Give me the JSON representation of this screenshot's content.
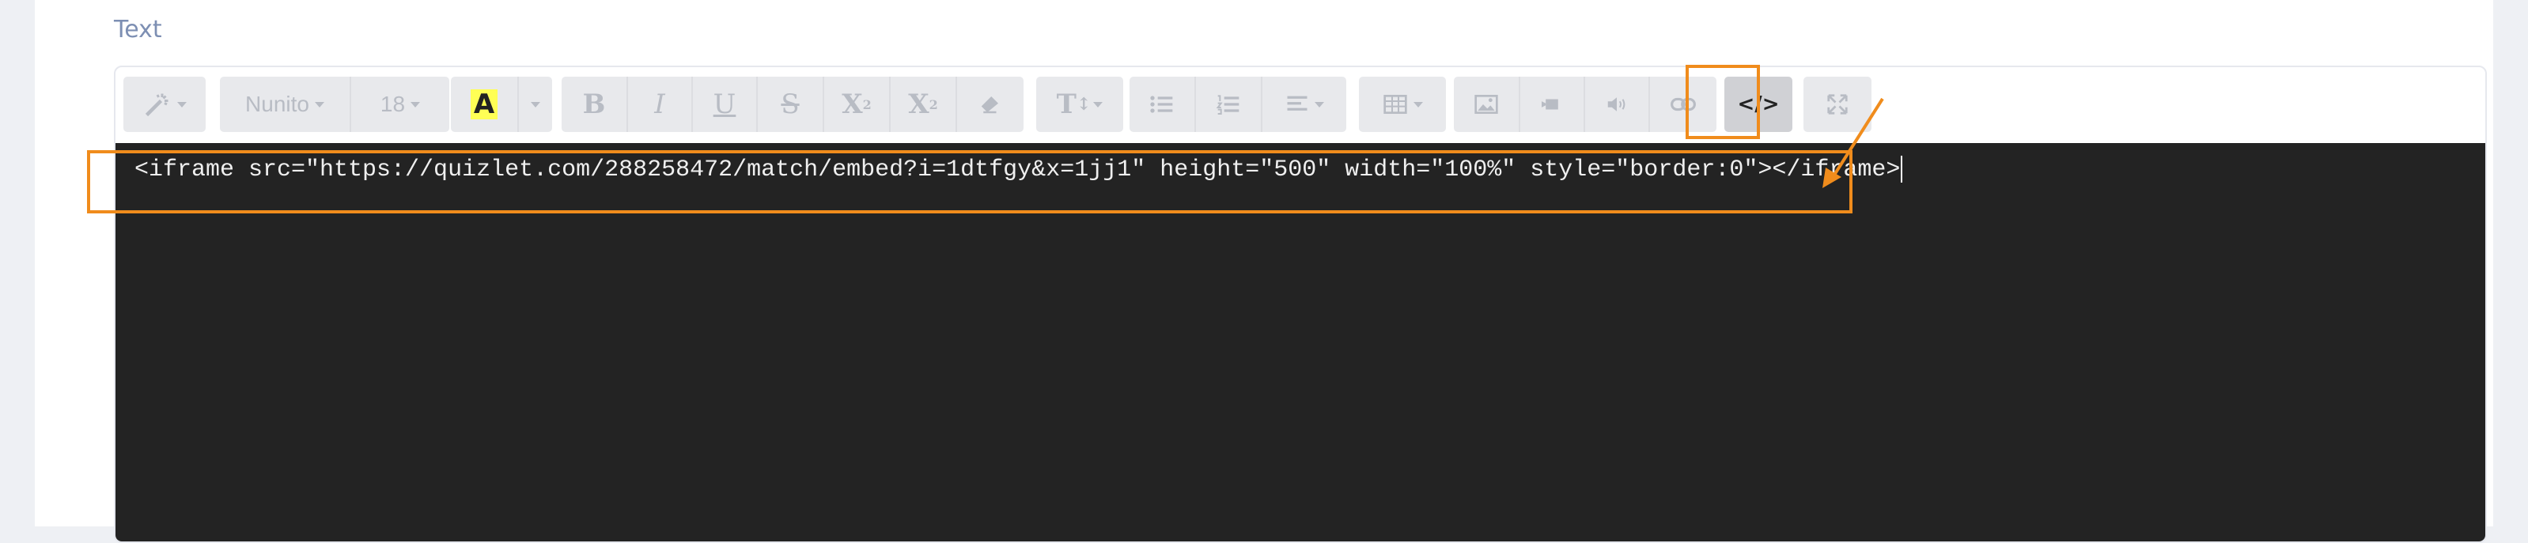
{
  "field": {
    "label": "Text"
  },
  "toolbar": {
    "font_name": "Nunito",
    "font_size": "18",
    "highlight_letter": "A",
    "bold": "B",
    "italic": "I",
    "underline": "U",
    "strike": "S",
    "superscript": "X",
    "superscript_mark": "2",
    "subscript": "X",
    "subscript_mark": "2",
    "text_size_icon": "T",
    "code_view": "</>",
    "active_button": "code-view",
    "highlight_color": "#ffff55"
  },
  "code": {
    "content": "<iframe src=\"https://quizlet.com/288258472/match/embed?i=1dtfgy&x=1jj1\" height=\"500\" width=\"100%\" style=\"border:0\"></iframe>"
  },
  "annotation": {
    "color": "#f08c1c"
  }
}
